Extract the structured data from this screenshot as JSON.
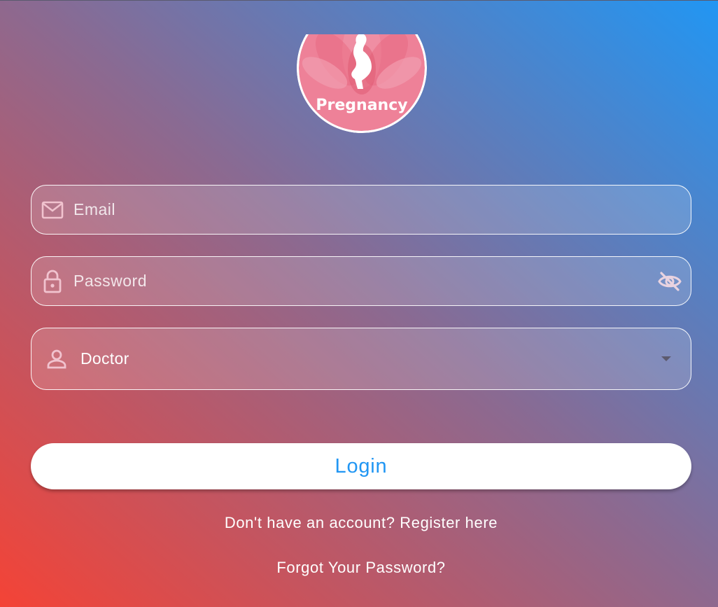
{
  "logo": {
    "text": "Pregnancy",
    "color": "#ef7f97"
  },
  "form": {
    "email": {
      "placeholder": "Email",
      "icon": "mail-icon"
    },
    "password": {
      "placeholder": "Password",
      "icon": "lock-icon",
      "toggle_icon": "eye-off-icon"
    },
    "role": {
      "value": "Doctor",
      "icon": "person-icon"
    }
  },
  "buttons": {
    "login_label": "Login"
  },
  "links": {
    "register": "Don't have an account? Register here",
    "forgot": "Forgot Your Password?"
  },
  "colors": {
    "accent": "#2196f3",
    "gradient_start": "#f44336",
    "gradient_end": "#2196f3"
  }
}
